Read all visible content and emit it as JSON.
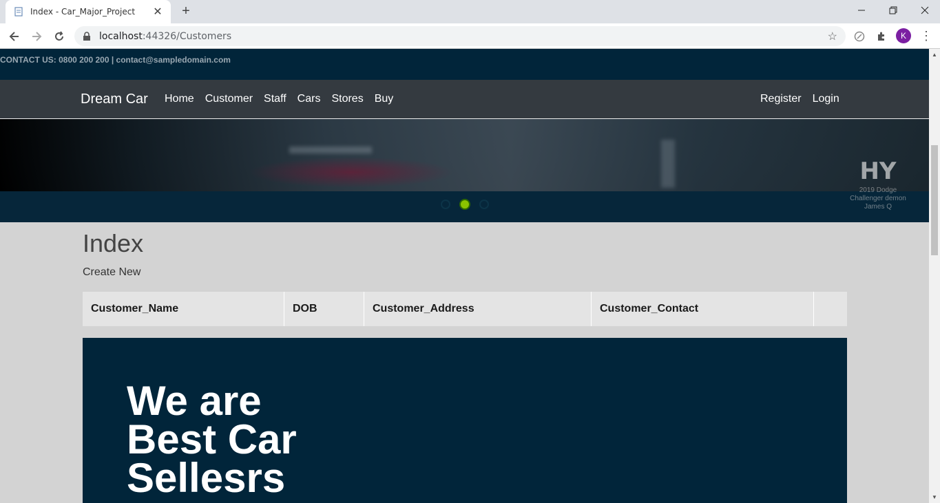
{
  "browser": {
    "tab_title": "Index - Car_Major_Project",
    "close_glyph": "✕",
    "new_tab_glyph": "+",
    "url_host": "localhost",
    "url_rest": ":44326/Customers",
    "avatar_letter": "K"
  },
  "site": {
    "contact": "CONTACT US: 0800 200 200 | contact@sampledomain.com",
    "brand": "Dream Car",
    "nav": [
      "Home",
      "Customer",
      "Staff",
      "Cars",
      "Stores",
      "Buy"
    ],
    "auth": [
      "Register",
      "Login"
    ],
    "banner": {
      "watermark_logo": "HY",
      "watermark_lines": [
        "2019 Dodge",
        "Challenger demon",
        "James Q"
      ],
      "active_slide": 2,
      "slide_count": 3
    }
  },
  "main": {
    "title": "Index",
    "create_link": "Create New",
    "columns": [
      "Customer_Name",
      "DOB",
      "Customer_Address",
      "Customer_Contact",
      ""
    ],
    "hero_lines": [
      "We are",
      "Best Car",
      "Sellesrs"
    ]
  },
  "colors": {
    "contact_bg": "#01253a",
    "navbar_bg": "#343a40",
    "active_dot": "#8bc400",
    "page_bg": "#d3d3d3"
  }
}
